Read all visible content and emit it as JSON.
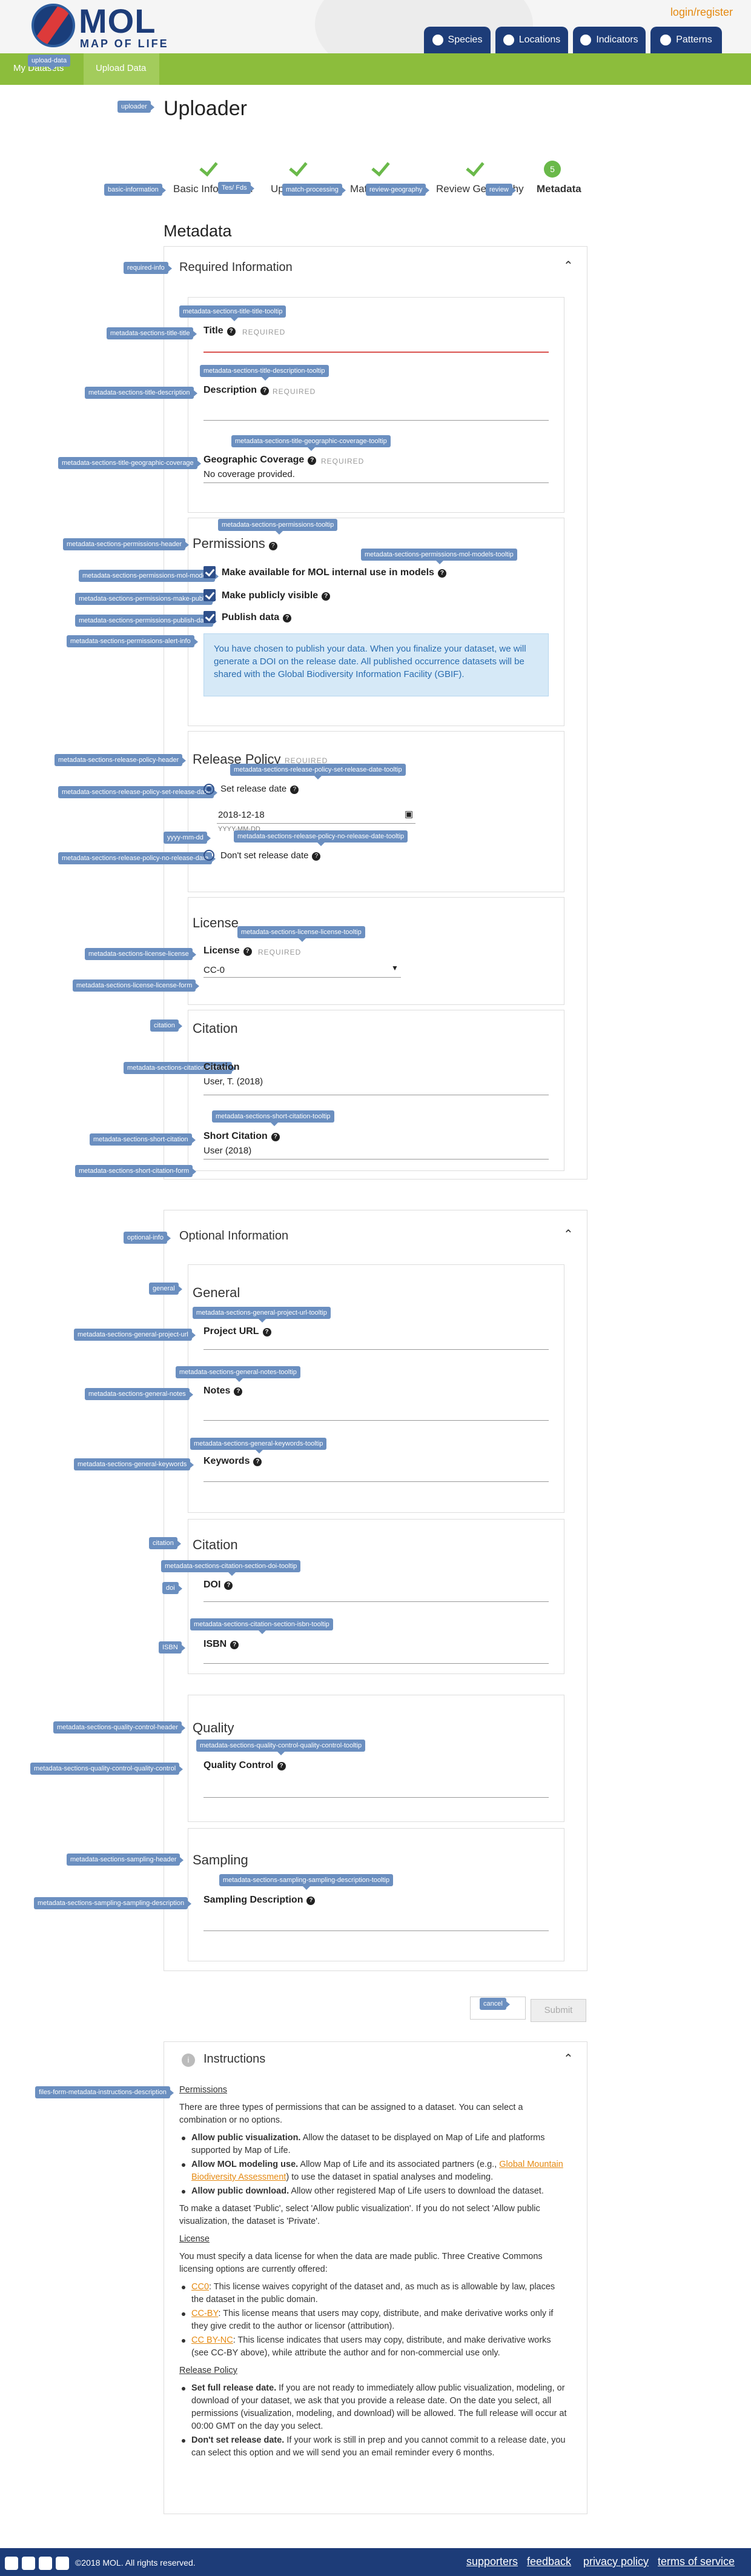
{
  "header": {
    "brand": "MOL",
    "brand_sub": "MAP OF LIFE",
    "login": "login/register",
    "nav": [
      "Species",
      "Locations",
      "Indicators",
      "Patterns"
    ]
  },
  "subnav": {
    "items": [
      "My Datasets",
      "Upload Data"
    ],
    "tag": "upload-data"
  },
  "page": {
    "title": "Uploader",
    "tag": "uploader"
  },
  "steps": {
    "labels": [
      "Basic Information",
      "Upload",
      "Match",
      "Review Geography",
      "Metadata"
    ],
    "tags": [
      "basic-information",
      "Tes/ Fds",
      "Match",
      "match-processing",
      "review-geography",
      "review"
    ],
    "current_number": "5"
  },
  "metadata_title": "Metadata",
  "required": {
    "tag": "required-info",
    "title": "Required Information",
    "title_field": {
      "label": "Title",
      "req": "REQUIRED",
      "tag": "metadata-sections-title-title",
      "tip": "metadata-sections-title-title-tooltip"
    },
    "description": {
      "label": "Description",
      "req": "REQUIRED",
      "tag": "metadata-sections-title-description",
      "tip": "metadata-sections-title-description-tooltip"
    },
    "geo": {
      "label": "Geographic Coverage",
      "req": "REQUIRED",
      "value": "No coverage provided.",
      "tag": "metadata-sections-title-geographic-coverage",
      "tip": "metadata-sections-title-geographic-coverage-tooltip"
    },
    "permissions": {
      "header": "Permissions",
      "tag": "metadata-sections-permissions-header",
      "tip": "metadata-sections-permissions-tooltip",
      "opts": [
        {
          "label": "Make available for MOL internal use in models",
          "tag": "metadata-sections-permissions-mol-models",
          "tip": "metadata-sections-permissions-mol-models-tooltip"
        },
        {
          "label": "Make publicly visible",
          "tag": "metadata-sections-permissions-make-public"
        },
        {
          "label": "Publish data",
          "tag": "metadata-sections-permissions-publish-data"
        }
      ],
      "alert_tag": "metadata-sections-permissions-alert-info",
      "alert": "You have chosen to publish your data. When you finalize your dataset, we will generate a DOI on the release date. All published occurrence datasets will be shared with the Global Biodiversity Information Facility (GBIF)."
    },
    "release": {
      "header": "Release Policy",
      "req": "REQUIRED",
      "tag": "metadata-sections-release-policy-header",
      "set_label": "Set release date",
      "set_tag": "metadata-sections-release-policy-set-release-date",
      "set_tip": "metadata-sections-release-policy-set-release-date-tooltip",
      "date": "2018-12-18",
      "date_hint": "YYYY-MM-DD",
      "date_tag": "yyyy-mm-dd",
      "none_label": "Don't set release date",
      "none_tag": "metadata-sections-release-policy-no-release-date",
      "none_tip": "metadata-sections-release-policy-no-release-date-tooltip"
    },
    "license": {
      "header": "License",
      "label": "License",
      "req": "REQUIRED",
      "value": "CC-0",
      "tag": "metadata-sections-license-license",
      "tip": "metadata-sections-license-license-tooltip",
      "form_tag": "metadata-sections-license-license-form"
    },
    "citation": {
      "header": "Citation",
      "tag": "citation",
      "cit_label": "Citation",
      "cit_value": "User, T. (2018)",
      "cit_tag": "metadata-sections-citation-citation",
      "short_label": "Short Citation",
      "short_value": "User (2018)",
      "short_tag": "metadata-sections-short-citation",
      "short_tip": "metadata-sections-short-citation-tooltip",
      "short_form_tag": "metadata-sections-short-citation-form"
    }
  },
  "optional": {
    "tag": "optional-info",
    "title": "Optional Information",
    "general": {
      "header": "General",
      "tag": "general",
      "url_label": "Project URL",
      "url_tag": "metadata-sections-general-project-url",
      "url_tip": "metadata-sections-general-project-url-tooltip",
      "notes_label": "Notes",
      "notes_tag": "metadata-sections-general-notes",
      "notes_tip": "metadata-sections-general-notes-tooltip",
      "kw_label": "Keywords",
      "kw_tag": "metadata-sections-general-keywords",
      "kw_tip": "metadata-sections-general-keywords-tooltip"
    },
    "citation": {
      "header": "Citation",
      "tag": "citation",
      "doi_label": "DOI",
      "doi_tag": "doi",
      "doi_tip": "metadata-sections-citation-section-doi-tooltip",
      "isbn_label": "ISBN",
      "isbn_tag": "ISBN",
      "isbn_tip": "metadata-sections-citation-section-isbn-tooltip"
    },
    "quality": {
      "header": "Quality",
      "tag": "metadata-sections-quality-control-header",
      "label": "Quality Control",
      "form_tag": "metadata-sections-quality-control-quality-control",
      "tip": "metadata-sections-quality-control-quality-control-tooltip"
    },
    "sampling": {
      "header": "Sampling",
      "tag": "metadata-sections-sampling-header",
      "label": "Sampling Description",
      "form_tag": "metadata-sections-sampling-sampling-description",
      "tip": "metadata-sections-sampling-sampling-description-tooltip"
    }
  },
  "actions": {
    "cancel_tag": "cancel",
    "submit": "Submit"
  },
  "instructions": {
    "title": "Instructions",
    "tag": "files-form-metadata-instructions-description",
    "perm_h": "Permissions",
    "perm_intro": "There are three types of permissions that can be assigned to a dataset. You can select a combination or no options.",
    "perm_items": [
      {
        "b": "Allow public visualization.",
        "t": " Allow the dataset to be displayed on Map of Life and platforms supported by Map of Life."
      },
      {
        "b": "Allow MOL modeling use.",
        "t1": " Allow Map of Life and its associated partners (e.g., ",
        "link": "Global Mountain Biodiversity Assessment",
        "t2": ") to use the dataset in spatial analyses and modeling."
      },
      {
        "b": "Allow public download.",
        "t": " Allow other registered Map of Life users to download the dataset."
      }
    ],
    "perm_outro": "To make a dataset 'Public', select 'Allow public visualization'. If you do not select 'Allow public visualization, the dataset is 'Private'.",
    "lic_h": "License",
    "lic_intro": "You must specify a data license for when the data are made public. Three Creative Commons licensing options are currently offered:",
    "lic_items": [
      {
        "link": "CC0",
        "t": ": This license waives copyright of the dataset and, as much as is allowable by law, places the dataset in the public domain."
      },
      {
        "link": "CC-BY",
        "t": ": This license means that users may copy, distribute, and make derivative works only if they give credit to the author or licensor (attribution)."
      },
      {
        "link": "CC BY-NC",
        "t": ": This license indicates that users may copy, distribute, and make derivative works (see CC-BY above), while attribute the author and for non-commercial use only."
      }
    ],
    "rel_h": "Release Policy",
    "rel_items": [
      {
        "b": "Set full release date.",
        "t": " If you are not ready to immediately allow public visualization, modeling, or download of your dataset, we ask that you provide a release date. On the date you select, all permissions (visualization, modeling, and download) will be allowed. The full release will occur at 00:00 GMT on the day you select."
      },
      {
        "b": "Don't set release date.",
        "t": " If your work is still in prep and you cannot commit to a release date, you can select this option and we will send you an email reminder every 6 months."
      }
    ]
  },
  "footer": {
    "copyright": "©2018 MOL. All rights reserved.",
    "links": [
      "supporters",
      "feedback",
      "privacy policy",
      "terms of service"
    ]
  }
}
